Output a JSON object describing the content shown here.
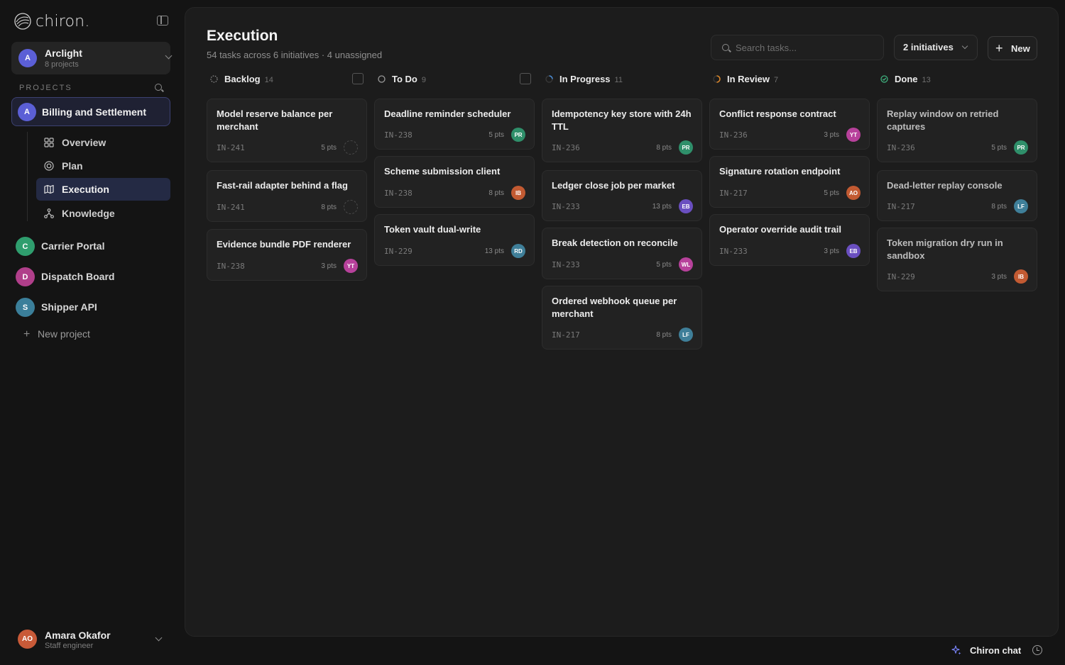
{
  "app": {
    "logo_text": "chiron."
  },
  "workspace": {
    "initial": "A",
    "name": "Arclight",
    "subtitle": "8 projects"
  },
  "sidebar": {
    "projects_label": "PROJECTS",
    "active_project": {
      "initial": "A",
      "name": "Billing and Settlement"
    },
    "subnav": [
      {
        "label": "Overview",
        "icon": "grid-icon"
      },
      {
        "label": "Plan",
        "icon": "target-icon"
      },
      {
        "label": "Execution",
        "icon": "map-icon"
      },
      {
        "label": "Knowledge",
        "icon": "network-icon"
      }
    ],
    "projects": [
      {
        "initial": "C",
        "name": "Carrier Portal",
        "color": "#2f9e6e"
      },
      {
        "initial": "D",
        "name": "Dispatch Board",
        "color": "#b03f8a"
      },
      {
        "initial": "S",
        "name": "Shipper API",
        "color": "#3b7f9a"
      }
    ],
    "new_project_label": "New project"
  },
  "user": {
    "initials": "AO",
    "name": "Amara Okafor",
    "role": "Staff engineer"
  },
  "header": {
    "title": "Execution",
    "subtitle": "54 tasks across 6 initiatives · 4 unassigned",
    "search_placeholder": "Search tasks...",
    "filter_label": "2 initiatives",
    "new_label": "New"
  },
  "columns": [
    {
      "name": "Backlog",
      "count": "14",
      "status_color": "#8a8a8a",
      "cards": [
        {
          "title": "Model reserve balance per merchant",
          "id": "IN-241",
          "pts": "5 pts",
          "assignee": "",
          "color": ""
        },
        {
          "title": "Fast-rail adapter behind a flag",
          "id": "IN-241",
          "pts": "8 pts",
          "assignee": "",
          "color": ""
        },
        {
          "title": "Evidence bundle PDF renderer",
          "id": "IN-238",
          "pts": "3 pts",
          "assignee": "YT",
          "color": "#b7419b"
        }
      ]
    },
    {
      "name": "To Do",
      "count": "9",
      "status_color": "#9a9a9a",
      "cards": [
        {
          "title": "Deadline reminder scheduler",
          "id": "IN-238",
          "pts": "5 pts",
          "assignee": "PR",
          "color": "#2f8f6a"
        },
        {
          "title": "Scheme submission client",
          "id": "IN-238",
          "pts": "8 pts",
          "assignee": "IB",
          "color": "#c25a32"
        },
        {
          "title": "Token vault dual-write",
          "id": "IN-229",
          "pts": "13 pts",
          "assignee": "RD",
          "color": "#3f7f99"
        }
      ]
    },
    {
      "name": "In Progress",
      "count": "11",
      "status_color": "#4c8fd8",
      "cards": [
        {
          "title": "Idempotency key store with 24h TTL",
          "id": "IN-236",
          "pts": "8 pts",
          "assignee": "PR",
          "color": "#2f8f6a"
        },
        {
          "title": "Ledger close job per market",
          "id": "IN-233",
          "pts": "13 pts",
          "assignee": "EB",
          "color": "#6a4fc0"
        },
        {
          "title": "Break detection on reconcile",
          "id": "IN-233",
          "pts": "5 pts",
          "assignee": "WL",
          "color": "#b7419b"
        },
        {
          "title": "Ordered webhook queue per merchant",
          "id": "IN-217",
          "pts": "8 pts",
          "assignee": "LF",
          "color": "#3f7f99"
        }
      ]
    },
    {
      "name": "In Review",
      "count": "7",
      "status_color": "#e0892a",
      "cards": [
        {
          "title": "Conflict response contract",
          "id": "IN-236",
          "pts": "3 pts",
          "assignee": "YT",
          "color": "#b7419b"
        },
        {
          "title": "Signature rotation endpoint",
          "id": "IN-217",
          "pts": "5 pts",
          "assignee": "AO",
          "color": "#c25a32"
        },
        {
          "title": "Operator override audit trail",
          "id": "IN-233",
          "pts": "3 pts",
          "assignee": "EB",
          "color": "#6a4fc0"
        }
      ]
    },
    {
      "name": "Done",
      "count": "13",
      "status_color": "#3fb27f",
      "cards": [
        {
          "title": "Replay window on retried captures",
          "id": "IN-236",
          "pts": "5 pts",
          "assignee": "PR",
          "color": "#2f8f6a"
        },
        {
          "title": "Dead-letter replay console",
          "id": "IN-217",
          "pts": "8 pts",
          "assignee": "LF",
          "color": "#3f7f99"
        },
        {
          "title": "Token migration dry run in sandbox",
          "id": "IN-229",
          "pts": "3 pts",
          "assignee": "IB",
          "color": "#c25a32"
        }
      ]
    }
  ],
  "footer": {
    "chat_label": "Chiron chat"
  }
}
